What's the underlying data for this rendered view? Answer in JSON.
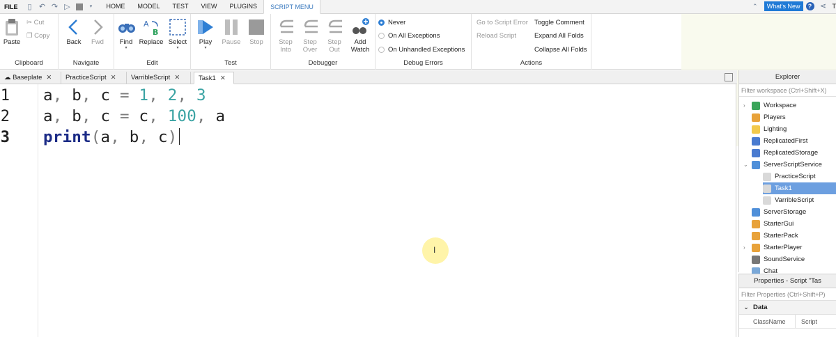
{
  "menubar": {
    "file": "FILE",
    "tabs": [
      "HOME",
      "MODEL",
      "TEST",
      "VIEW",
      "PLUGINS",
      "SCRIPT MENU"
    ],
    "active_tab": "SCRIPT MENU",
    "whats_new": "What's New",
    "user_partial": "T"
  },
  "ribbon": {
    "clipboard": {
      "label": "Clipboard",
      "paste": "Paste",
      "cut": "Cut",
      "copy": "Copy"
    },
    "navigate": {
      "label": "Navigate",
      "back": "Back",
      "fwd": "Fwd"
    },
    "edit": {
      "label": "Edit",
      "find": "Find",
      "replace": "Replace",
      "select": "Select"
    },
    "test": {
      "label": "Test",
      "play": "Play",
      "pause": "Pause",
      "stop": "Stop"
    },
    "debugger": {
      "label": "Debugger",
      "step_into": [
        "Step",
        "Into"
      ],
      "step_over": [
        "Step",
        "Over"
      ],
      "step_out": [
        "Step",
        "Out"
      ],
      "add_watch": [
        "Add",
        "Watch"
      ]
    },
    "debug_errors": {
      "label": "Debug Errors",
      "options": [
        "Never",
        "On All Exceptions",
        "On Unhandled Exceptions"
      ],
      "selected": "Never"
    },
    "actions": {
      "label": "Actions",
      "go_to_script_error": "Go to Script Error",
      "reload_script": "Reload Script",
      "toggle_comment": "Toggle Comment",
      "expand_all_folds": "Expand All Folds",
      "collapse_all_folds": "Collapse All Folds"
    }
  },
  "tabs": [
    {
      "label": "Baseplate"
    },
    {
      "label": "PracticeScript"
    },
    {
      "label": "VarribleScript"
    },
    {
      "label": "Task1"
    }
  ],
  "active_tab": "Task1",
  "editor": {
    "line_numbers": [
      "1",
      "2",
      "3"
    ],
    "current_line": "3",
    "lines": [
      [
        {
          "t": "a",
          "c": "txt"
        },
        {
          "t": ", ",
          "c": "op"
        },
        {
          "t": "b",
          "c": "txt"
        },
        {
          "t": ", ",
          "c": "op"
        },
        {
          "t": "c",
          "c": "txt"
        },
        {
          "t": " = ",
          "c": "op"
        },
        {
          "t": "1",
          "c": "num"
        },
        {
          "t": ", ",
          "c": "op"
        },
        {
          "t": "2",
          "c": "num"
        },
        {
          "t": ", ",
          "c": "op"
        },
        {
          "t": "3",
          "c": "num"
        }
      ],
      [
        {
          "t": "a",
          "c": "txt"
        },
        {
          "t": ", ",
          "c": "op"
        },
        {
          "t": "b",
          "c": "txt"
        },
        {
          "t": ", ",
          "c": "op"
        },
        {
          "t": "c",
          "c": "txt"
        },
        {
          "t": " = ",
          "c": "op"
        },
        {
          "t": "c",
          "c": "txt"
        },
        {
          "t": ", ",
          "c": "op"
        },
        {
          "t": "100",
          "c": "num"
        },
        {
          "t": ", ",
          "c": "op"
        },
        {
          "t": "a",
          "c": "txt"
        }
      ],
      [
        {
          "t": "print",
          "c": "kw"
        },
        {
          "t": "(",
          "c": "op"
        },
        {
          "t": "a",
          "c": "txt"
        },
        {
          "t": ", ",
          "c": "op"
        },
        {
          "t": "b",
          "c": "txt"
        },
        {
          "t": ", ",
          "c": "op"
        },
        {
          "t": "c",
          "c": "txt"
        },
        {
          "t": ")",
          "c": "op"
        }
      ]
    ]
  },
  "explorer": {
    "title": "Explorer",
    "filter_placeholder": "Filter workspace (Ctrl+Shift+X)",
    "items": [
      {
        "label": "Workspace",
        "icon": "globe-icon",
        "color": "#3aa55a",
        "expand": "›"
      },
      {
        "label": "Players",
        "icon": "players-icon",
        "color": "#e8a23a",
        "expand": ""
      },
      {
        "label": "Lighting",
        "icon": "bulb-icon",
        "color": "#f2c94c",
        "expand": ""
      },
      {
        "label": "ReplicatedFirst",
        "icon": "replicated-first-icon",
        "color": "#4a7bd0",
        "expand": ""
      },
      {
        "label": "ReplicatedStorage",
        "icon": "replicated-storage-icon",
        "color": "#4a7bd0",
        "expand": ""
      },
      {
        "label": "ServerScriptService",
        "icon": "server-script-service-icon",
        "color": "#4f8fd9",
        "expand": "⌄"
      },
      {
        "label": "PracticeScript",
        "icon": "script-icon",
        "color": "#d9d9d9",
        "expand": "",
        "child": true
      },
      {
        "label": "Task1",
        "icon": "script-icon",
        "color": "#d9d9d9",
        "expand": "",
        "child": true,
        "selected": true
      },
      {
        "label": "VarribleScript",
        "icon": "script-icon",
        "color": "#d9d9d9",
        "expand": "",
        "child": true
      },
      {
        "label": "ServerStorage",
        "icon": "server-storage-icon",
        "color": "#4f8fd9",
        "expand": ""
      },
      {
        "label": "StarterGui",
        "icon": "starter-gui-icon",
        "color": "#e8a23a",
        "expand": ""
      },
      {
        "label": "StarterPack",
        "icon": "starter-pack-icon",
        "color": "#e8a23a",
        "expand": ""
      },
      {
        "label": "StarterPlayer",
        "icon": "starter-player-icon",
        "color": "#e8a23a",
        "expand": "›"
      },
      {
        "label": "SoundService",
        "icon": "speaker-icon",
        "color": "#777777",
        "expand": ""
      },
      {
        "label": "Chat",
        "icon": "chat-icon",
        "color": "#7aa8d8",
        "expand": ""
      }
    ]
  },
  "properties": {
    "title": "Properties - Script \"Tas",
    "filter_placeholder": "Filter Properties (Ctrl+Shift+P)",
    "section": "Data",
    "columns": [
      "ClassName",
      "Script"
    ]
  },
  "colors": {
    "accent": "#3c7bbf",
    "selection": "#6c9fe0",
    "number": "#3aa3a3",
    "keyword": "#1b2b86"
  }
}
